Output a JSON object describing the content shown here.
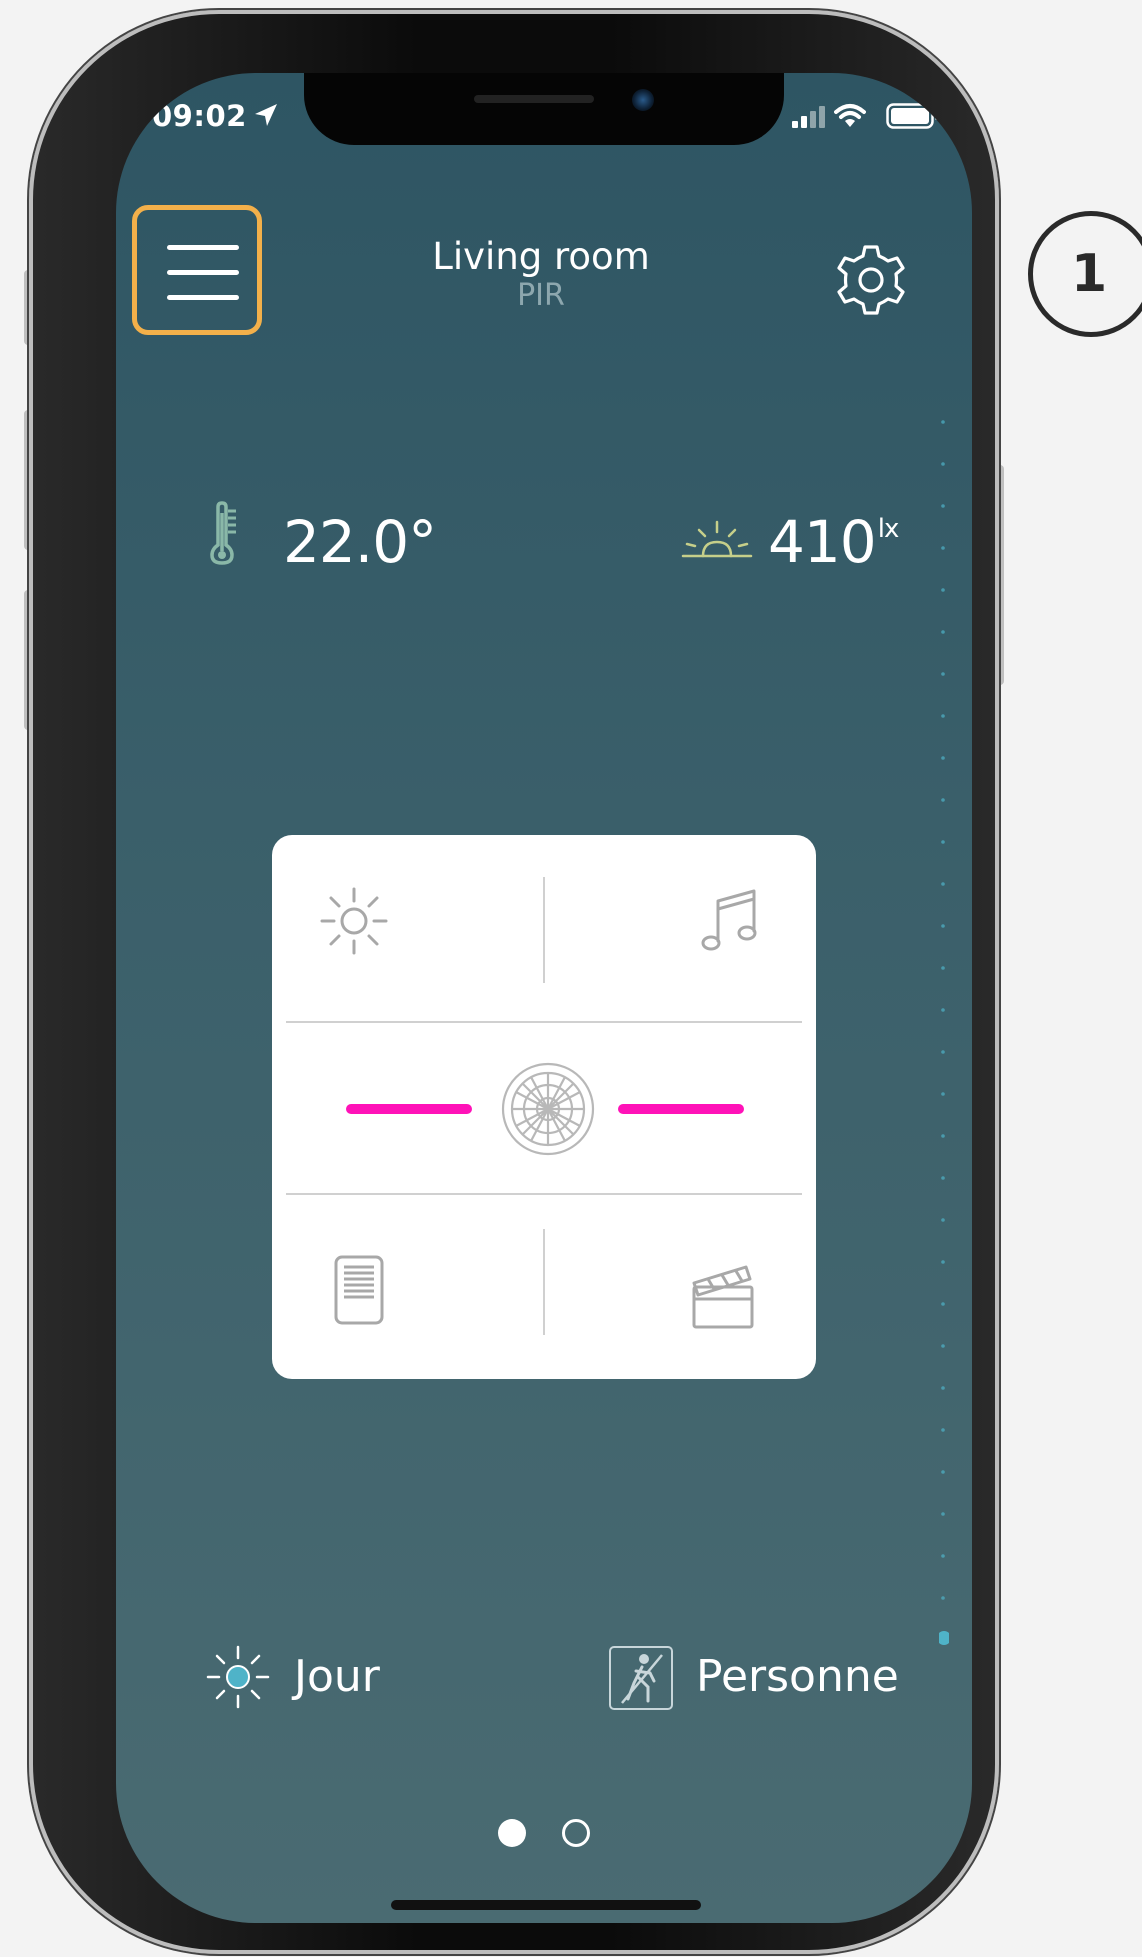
{
  "status_bar": {
    "time": "09:02"
  },
  "header": {
    "title": "Living room",
    "subtitle": "PIR"
  },
  "sensors": {
    "temperature": "22.0°",
    "lux_value": "410",
    "lux_unit": "lx"
  },
  "footer": {
    "mode_label": "Jour",
    "presence_label": "Personne"
  },
  "pagination": {
    "current_page": 1,
    "total_pages": 2
  },
  "annotation": {
    "step_number": "1"
  },
  "colors": {
    "background": "#2e5563",
    "accent_highlight": "#f3b04a",
    "slider": "#ff12b8",
    "sun_icon_accent": "#4fb3c8"
  },
  "icons": [
    "menu-icon",
    "gear-icon",
    "thermometer-icon",
    "sunrise-icon",
    "sun-icon",
    "music-note-icon",
    "fan-grille-icon",
    "shutter-icon",
    "clapperboard-icon",
    "presence-icon",
    "location-arrow-icon",
    "signal-icon",
    "wifi-icon",
    "battery-icon"
  ]
}
